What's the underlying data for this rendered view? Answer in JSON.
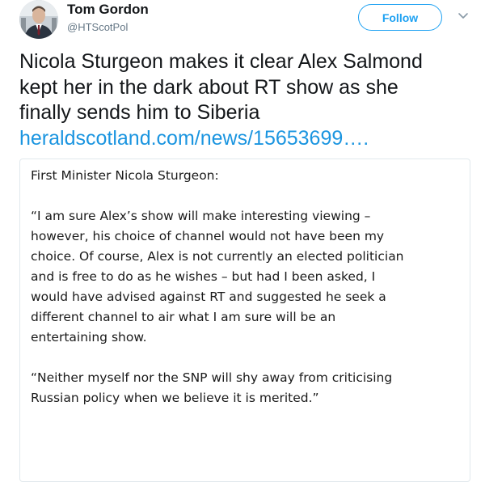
{
  "author": {
    "name": "Tom Gordon",
    "handle": "@HTScotPol",
    "avatar_icon": "profile-photo"
  },
  "actions": {
    "follow_label": "Follow",
    "menu_icon": "chevron-down-icon"
  },
  "tweet": {
    "text_lines": [
      "Nicola Sturgeon makes it clear Alex Salmond",
      "kept her in the dark about RT show as she",
      "finally sends him to Siberia"
    ],
    "link_text": "heraldscotland.com/news/15653699…."
  },
  "quoted_image": {
    "heading": "First Minister Nicola Sturgeon:",
    "paragraph1_lines": [
      "“I am sure Alex’s show will make interesting viewing –",
      "however,  his choice of channel would not have been my",
      "choice. Of course, Alex is not currently an elected politician",
      "and is free to do as he wishes – but had I been asked, I",
      "would have advised against RT and suggested he seek a",
      "different channel to air what I am sure will be an",
      "entertaining show."
    ],
    "paragraph2_lines": [
      "“Neither myself nor the SNP will shy away from criticising",
      "Russian policy when we believe it is merited.”"
    ]
  },
  "colors": {
    "accent": "#1da1f2",
    "link": "#1b95e0",
    "text": "#14171a",
    "secondary_text": "#657786",
    "card_border": "#e1e8ed"
  }
}
